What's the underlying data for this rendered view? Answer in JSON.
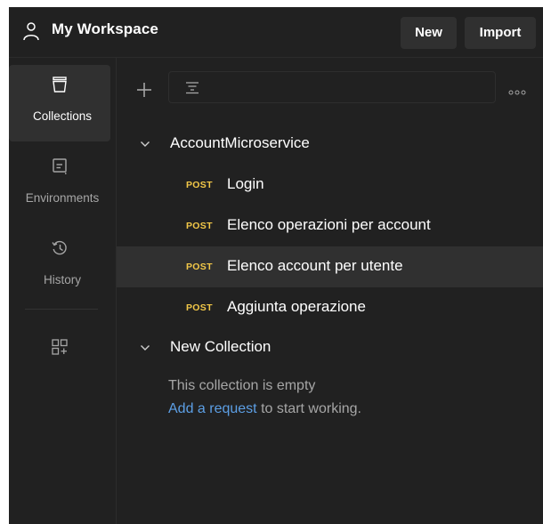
{
  "header": {
    "workspace_title": "My Workspace",
    "new_label": "New",
    "import_label": "Import",
    "workspace_icon": "user-icon"
  },
  "sidebar": {
    "items": [
      {
        "label": "Collections",
        "icon": "collections-icon",
        "active": true
      },
      {
        "label": "Environments",
        "icon": "environments-icon",
        "active": false
      },
      {
        "label": "History",
        "icon": "history-icon",
        "active": false
      }
    ],
    "extra_icon": "add-apps-icon"
  },
  "main": {
    "toolbar": {
      "add_icon": "plus-icon",
      "filter_icon": "filter-icon",
      "more_icon": "more-options-icon"
    },
    "collections": [
      {
        "name": "AccountMicroservice",
        "expanded": true,
        "requests": [
          {
            "method": "POST",
            "name": "Login"
          },
          {
            "method": "POST",
            "name": "Elenco operazioni per account"
          },
          {
            "method": "POST",
            "name": "Elenco account per utente"
          },
          {
            "method": "POST",
            "name": "Aggiunta operazione"
          }
        ]
      },
      {
        "name": "New Collection",
        "expanded": true,
        "empty_text": "This collection is empty",
        "add_request_link": "Add a request",
        "add_request_suffix": " to start working."
      }
    ]
  },
  "colors": {
    "background": "#212121",
    "active": "#303030",
    "method_post": "#f3c848",
    "link": "#5c9fe5",
    "muted_text": "#a6a6a6"
  }
}
